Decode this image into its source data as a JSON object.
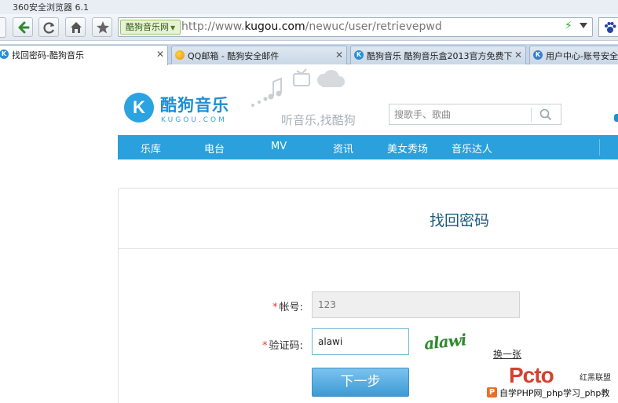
{
  "browser": {
    "title": "360安全浏览器 6.1",
    "site_badge": "酷狗音乐网",
    "url_prefix": "http://www.",
    "url_domain": "kugou.com",
    "url_path": "/newuc/user/retrievepwd"
  },
  "tabs": [
    {
      "label": "找回密码-酷狗音乐",
      "icon": "kugou-icon",
      "active": true
    },
    {
      "label": "QQ邮箱 - 酷狗安全邮件",
      "icon": "qq-icon",
      "active": false
    },
    {
      "label": "酷狗音乐 酷狗音乐盒2013官方免费下",
      "icon": "kugou-icon",
      "active": false
    },
    {
      "label": "用户中心-账号安全",
      "icon": "user-icon",
      "active": false
    }
  ],
  "site": {
    "logo_letter": "K",
    "logo_text": "酷狗音乐",
    "logo_sub": "KUGOU.COM",
    "slogan": "听音乐,找酷狗",
    "search_placeholder": "搜歌手、歌曲",
    "nav": [
      "乐库",
      "电台",
      "MV",
      "资讯",
      "美女秀场",
      "音乐达人"
    ]
  },
  "form": {
    "title": "找回密码",
    "required_mark": "*",
    "account_label": "帐号:",
    "account_value": "123",
    "captcha_label": "验证码:",
    "captcha_value": "alawi",
    "captcha_image_text": "alawi",
    "refresh_label": "换一张",
    "next_label": "下一步"
  },
  "watermark": {
    "brand": "Pcto",
    "brand_cn": "红黑联盟",
    "footer": "自学PHP网_php学习_php教"
  },
  "colors": {
    "accent": "#2aa0dd",
    "title_text": "#1b5a7a",
    "required": "#e33333"
  }
}
